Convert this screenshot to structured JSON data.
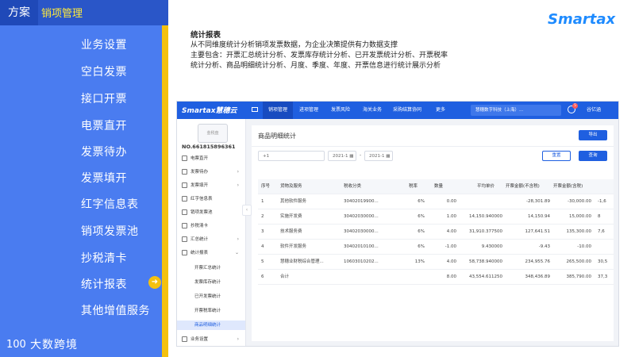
{
  "left": {
    "tag1": "方案",
    "tag2": "销项管理",
    "menu": [
      "业务设置",
      "空白发票",
      "接口开票",
      "电票直开",
      "发票待办",
      "发票填开",
      "红字信息表",
      "销项发票池",
      "抄税清卡",
      "统计报表",
      "其他增值服务"
    ],
    "active_index": 9,
    "brand": "大数跨境"
  },
  "desc": {
    "title": "统计报表",
    "line1": "从不同维度统计分析销项发票数据，为企业决策提供有力数据支撑",
    "line2": "主要包含：开票汇总统计分析、发票库存统计分析、已开发票统计分析、开票税率",
    "line3": "统计分析、商品明细统计分析、月度、季度、年度、开票信息进行统计展示分析"
  },
  "logo": "Smartax",
  "app": {
    "brand": "Smartax慧穗云",
    "nav": [
      "销项管理",
      "进项管理",
      "发票风险",
      "海关业务",
      "采购结算协同",
      "更多"
    ],
    "nav_active": 0,
    "company": "慧穗数字科技（上海）...",
    "badge": "5",
    "user": "谷亿涵",
    "stamp": "金税盘",
    "taxno": "NO.661815896361",
    "side": [
      {
        "label": "电票直开",
        "arrow": ""
      },
      {
        "label": "发票待办",
        "arrow": "›"
      },
      {
        "label": "发票填开",
        "arrow": "›"
      },
      {
        "label": "红字信息表",
        "arrow": ""
      },
      {
        "label": "销项发票池",
        "arrow": ""
      },
      {
        "label": "抄税清卡",
        "arrow": ""
      },
      {
        "label": "汇总统计",
        "arrow": "›"
      },
      {
        "label": "统计报表",
        "arrow": "⌄"
      }
    ],
    "sub": [
      "开票汇总统计",
      "发票库存统计",
      "已开发票统计",
      "开票税率统计",
      "商品明细统计"
    ],
    "sub_active": 4,
    "side_last": "业务设置",
    "collapse": "‹",
    "panel": {
      "title": "商品明细统计",
      "export": "导出",
      "filter1": "+1",
      "date1": "2021-1",
      "date2": "2021-1",
      "dash": "-",
      "reset": "重置",
      "query": "查询",
      "headers": [
        "序号",
        "货物及服务",
        "税收分类",
        "税率",
        "数量",
        "平均单价",
        "开票金额(不含税)",
        "开票金额(含税)",
        ""
      ],
      "rows": [
        [
          "1",
          "其他软件服务",
          "30402019900...",
          "6%",
          "0.00",
          "",
          "-28,301.89",
          "-30,000.00",
          "-1,6"
        ],
        [
          "2",
          "实施开发费",
          "30402030000...",
          "6%",
          "1.00",
          "14,150.940000",
          "14,150.94",
          "15,000.00",
          "8"
        ],
        [
          "3",
          "技术服务费",
          "30402030000...",
          "6%",
          "4.00",
          "31,910.377500",
          "127,641.51",
          "135,300.00",
          "7,6"
        ],
        [
          "4",
          "软件开发服务",
          "30402010100...",
          "6%",
          "-1.00",
          "9.430000",
          "-9.43",
          "-10.00",
          ""
        ],
        [
          "5",
          "慧穗业财税综合管理...",
          "10603010202...",
          "13%",
          "4.00",
          "58,738.940000",
          "234,955.76",
          "265,500.00",
          "30,5"
        ],
        [
          "6",
          "合计",
          "",
          "",
          "8.00",
          "43,554.611250",
          "348,436.89",
          "385,790.00",
          "37,3"
        ]
      ]
    }
  }
}
